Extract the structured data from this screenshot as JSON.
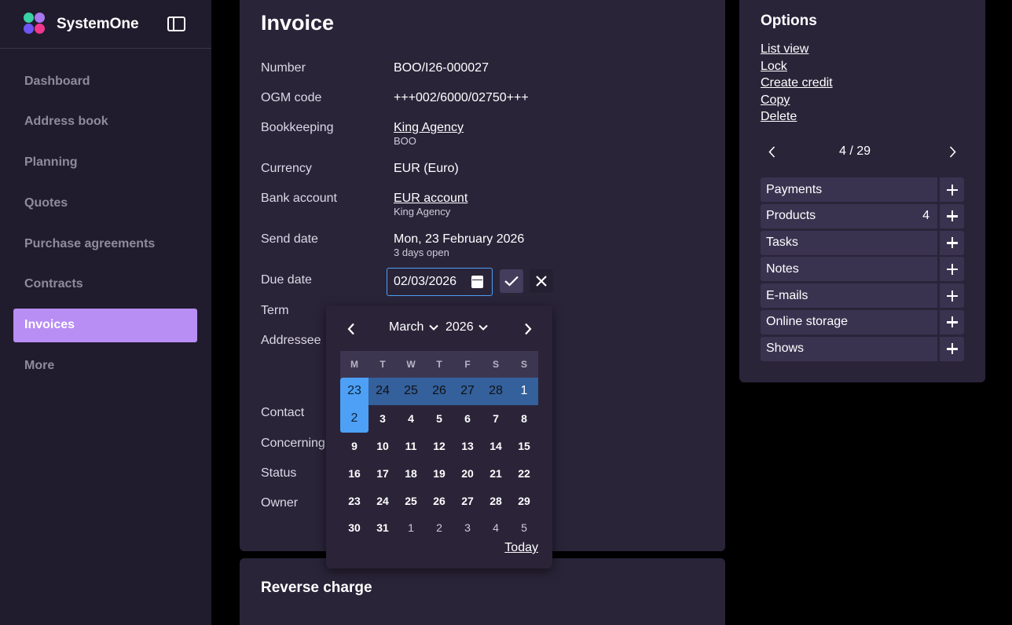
{
  "app": {
    "name": "SystemOne"
  },
  "sidebar": {
    "items": [
      {
        "label": "Dashboard",
        "active": false
      },
      {
        "label": "Address book",
        "active": false
      },
      {
        "label": "Planning",
        "active": false
      },
      {
        "label": "Quotes",
        "active": false
      },
      {
        "label": "Purchase agreements",
        "active": false
      },
      {
        "label": "Contracts",
        "active": false
      },
      {
        "label": "Invoices",
        "active": true
      },
      {
        "label": "More",
        "active": false
      }
    ]
  },
  "invoice": {
    "title": "Invoice",
    "fields": {
      "number": {
        "label": "Number",
        "value": "BOO/I26-000027"
      },
      "ogm": {
        "label": "OGM code",
        "value": "+++002/6000/02750+++"
      },
      "bookkeeping": {
        "label": "Bookkeeping",
        "value": "King Agency",
        "sub": "BOO"
      },
      "currency": {
        "label": "Currency",
        "value": "EUR (Euro)"
      },
      "bank": {
        "label": "Bank account",
        "value": "EUR account",
        "sub": "King Agency"
      },
      "send_date": {
        "label": "Send date",
        "value": "Mon, 23 February 2026",
        "sub": "3 days open"
      },
      "due_date": {
        "label": "Due date",
        "value": "02/03/2026"
      },
      "term": {
        "label": "Term"
      },
      "addressee": {
        "label": "Addressee"
      },
      "contact": {
        "label": "Contact"
      },
      "concerning": {
        "label": "Concerning"
      },
      "status": {
        "label": "Status"
      },
      "owner": {
        "label": "Owner"
      }
    }
  },
  "datepicker": {
    "month": "March",
    "year": "2026",
    "weekdays": [
      "M",
      "T",
      "W",
      "T",
      "F",
      "S",
      "S"
    ],
    "weeks": [
      [
        "23",
        "24",
        "25",
        "26",
        "27",
        "28",
        "1"
      ],
      [
        "2",
        "3",
        "4",
        "5",
        "6",
        "7",
        "8"
      ],
      [
        "9",
        "10",
        "11",
        "12",
        "13",
        "14",
        "15"
      ],
      [
        "16",
        "17",
        "18",
        "19",
        "20",
        "21",
        "22"
      ],
      [
        "23",
        "24",
        "25",
        "26",
        "27",
        "28",
        "29"
      ],
      [
        "30",
        "31",
        "1",
        "2",
        "3",
        "4",
        "5"
      ]
    ],
    "today_label": "Today"
  },
  "reverse_charge": {
    "title": "Reverse charge"
  },
  "options": {
    "title": "Options",
    "links": [
      "List view",
      "Lock",
      "Create credit",
      "Copy",
      "Delete"
    ],
    "pager": "4 / 29",
    "relations": [
      {
        "label": "Payments",
        "count": ""
      },
      {
        "label": "Products",
        "count": "4"
      },
      {
        "label": "Tasks",
        "count": ""
      },
      {
        "label": "Notes",
        "count": ""
      },
      {
        "label": "E-mails",
        "count": ""
      },
      {
        "label": "Online storage",
        "count": ""
      },
      {
        "label": "Shows",
        "count": ""
      }
    ]
  },
  "colors": {
    "accent": "#b88df4",
    "selection": "#4da0f5",
    "week_highlight": "#34609c",
    "card": "#2a2439",
    "sidebar": "#201c2d"
  }
}
